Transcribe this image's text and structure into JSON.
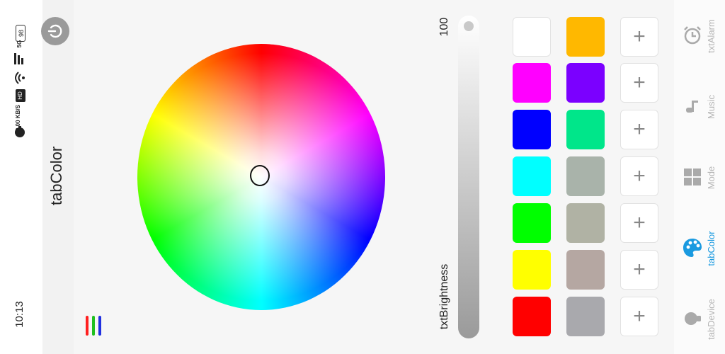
{
  "status": {
    "time": "10:13",
    "speed": "0.00 KB/S",
    "network": "5G",
    "battery": "98"
  },
  "page": {
    "title": "tabColor"
  },
  "brightness": {
    "label": "txtBrightness",
    "value": "100",
    "level_percent": 100
  },
  "swatches": {
    "column1": [
      "#ffffff",
      "#ff00ff",
      "#0000ff",
      "#00ffff",
      "#00ff00",
      "#ffff00",
      "#ff0000"
    ],
    "column2": [
      "#ffb800",
      "#7b00ff",
      "#00e68a",
      "#a9b3aa",
      "#b0b2a4",
      "#b5a7a2",
      "#a9a9ad"
    ],
    "add_label": "+"
  },
  "nav": {
    "items": [
      {
        "label": "txtAlarm",
        "icon": "alarm-clock-icon",
        "active": false
      },
      {
        "label": "Music",
        "icon": "music-note-icon",
        "active": false
      },
      {
        "label": "Mode",
        "icon": "grid-icon",
        "active": false
      },
      {
        "label": "tabColor",
        "icon": "palette-icon",
        "active": true
      },
      {
        "label": "tabDevice",
        "icon": "bulb-icon",
        "active": false
      }
    ]
  },
  "colors": {
    "accent": "#1a9ae0",
    "inactive": "#b5b5b5"
  }
}
